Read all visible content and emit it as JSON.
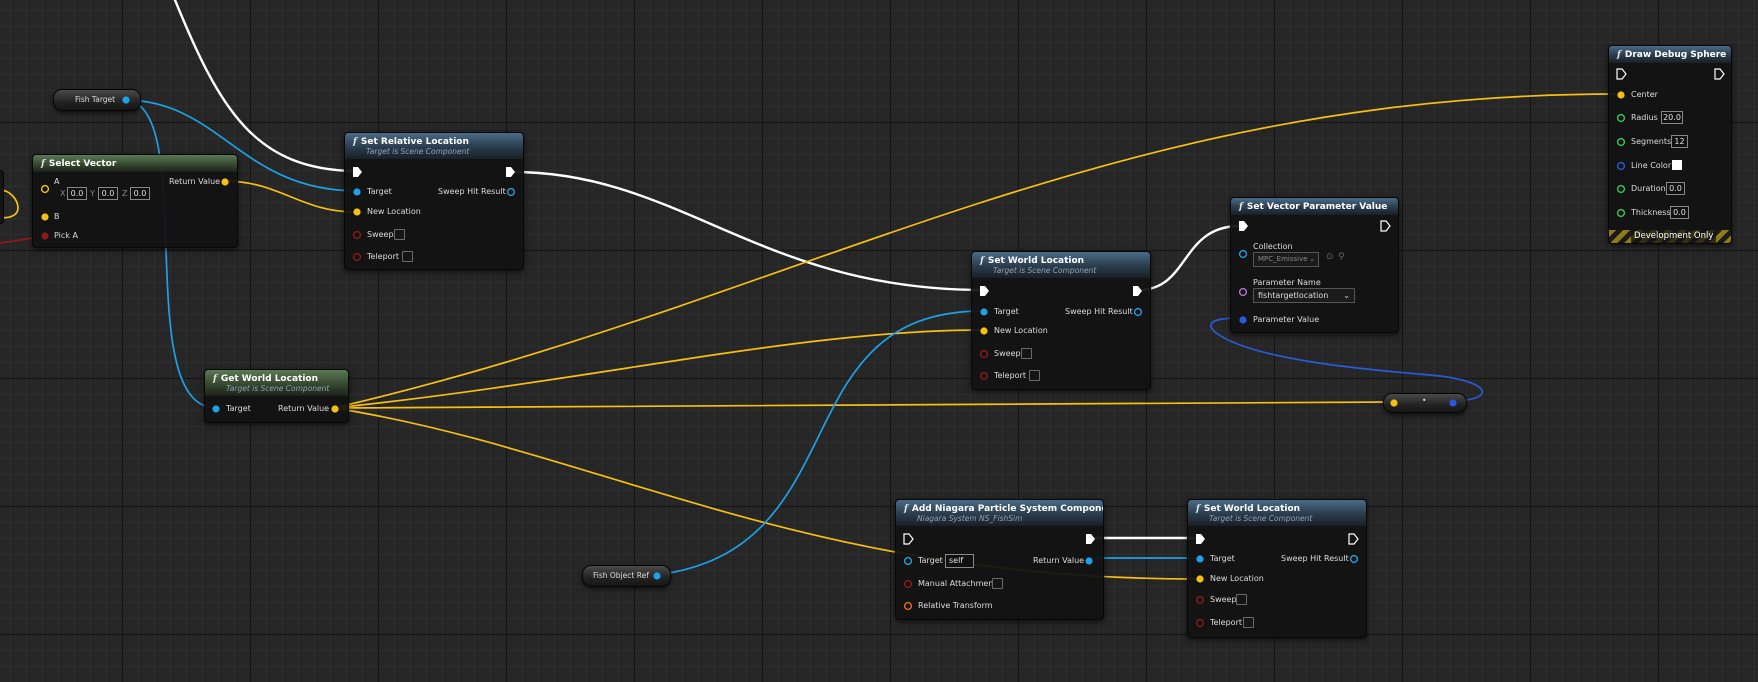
{
  "colors": {
    "exec": "#ffffff",
    "vector": "#f5c012",
    "object": "#1da1e6",
    "boolean": "#8e1a1a",
    "float": "#33cc55",
    "linear_color": "#2a5bd7",
    "name": "#b46fd1",
    "transform": "#e86a1d"
  },
  "nodes": {
    "fish_target": {
      "label": "Fish Target"
    },
    "fish_object_ref": {
      "label": "Fish Object Ref"
    },
    "reroute": {
      "label": ""
    },
    "select_vector": {
      "title": "Select Vector",
      "pin_a": "A",
      "pin_b": "B",
      "pin_pick_a": "Pick A",
      "return_value": "Return Value",
      "x_label": "X",
      "y_label": "Y",
      "z_label": "Z",
      "x": "0.0",
      "y": "0.0",
      "z": "0.0"
    },
    "set_relative_location": {
      "title": "Set Relative Location",
      "subtitle": "Target is Scene Component",
      "target": "Target",
      "new_location": "New Location",
      "sweep": "Sweep",
      "teleport": "Teleport",
      "sweep_hit_result": "Sweep Hit Result"
    },
    "get_world_location": {
      "title": "Get World Location",
      "subtitle": "Target is Scene Component",
      "target": "Target",
      "return_value": "Return Value"
    },
    "set_world_location_1": {
      "title": "Set World Location",
      "subtitle": "Target is Scene Component",
      "target": "Target",
      "new_location": "New Location",
      "sweep": "Sweep",
      "teleport": "Teleport",
      "sweep_hit_result": "Sweep Hit Result"
    },
    "set_vector_parameter_value": {
      "title": "Set Vector Parameter Value",
      "collection": "Collection",
      "collection_value": "MPC_Emissive",
      "parameter_name": "Parameter Name",
      "parameter_name_value": "fishtargetlocation",
      "parameter_value": "Parameter Value"
    },
    "draw_debug_sphere": {
      "title": "Draw Debug Sphere",
      "center": "Center",
      "radius": "Radius",
      "radius_value": "20.0",
      "segments": "Segments",
      "segments_value": "12",
      "line_color": "Line Color",
      "duration": "Duration",
      "duration_value": "0.0",
      "thickness": "Thickness",
      "thickness_value": "0.0",
      "dev_only": "Development Only"
    },
    "add_niagara": {
      "title": "Add Niagara Particle System Component",
      "subtitle": "Niagara System NS_FishSim",
      "target": "Target",
      "target_value": "self",
      "manual_attachment": "Manual Attachment",
      "relative_transform": "Relative Transform",
      "return_value": "Return Value"
    },
    "set_world_location_2": {
      "title": "Set World Location",
      "subtitle": "Target is Scene Component",
      "target": "Target",
      "new_location": "New Location",
      "sweep": "Sweep",
      "teleport": "Teleport",
      "sweep_hit_result": "Sweep Hit Result"
    }
  }
}
